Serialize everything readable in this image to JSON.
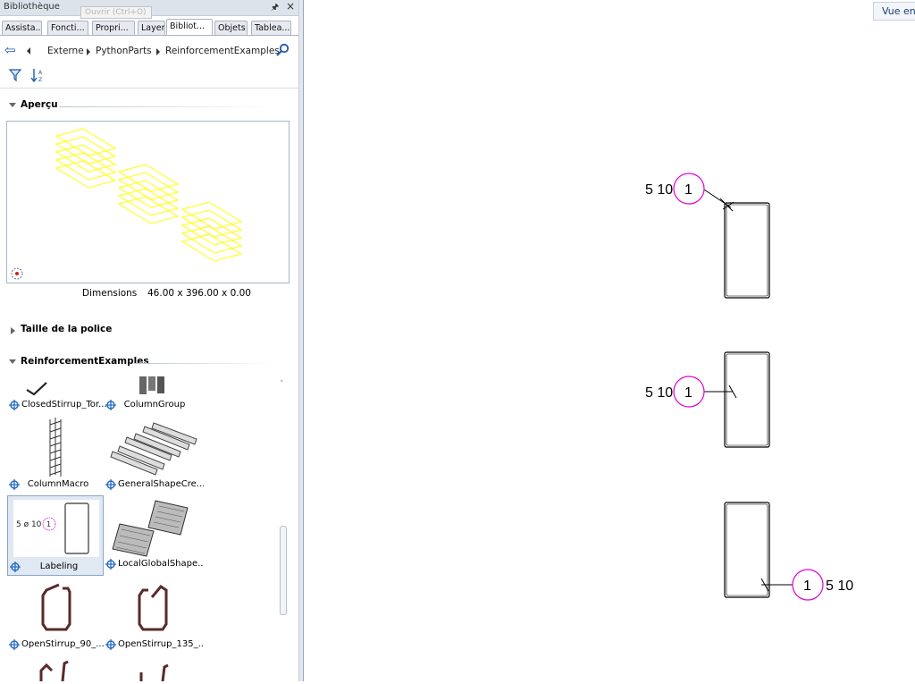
{
  "panel": {
    "title": "Bibliothèque",
    "pin_icon": "pin-icon",
    "close_icon": "close-icon",
    "tooltip_text": "Ouvrir (Ctrl+O)"
  },
  "tabs": [
    "Assista...",
    "Foncti...",
    "Propri...",
    "Layer",
    "Bibliot...",
    "Objets",
    "Tablea..."
  ],
  "active_tab": "Bibliot...",
  "breadcrumb": [
    "Externe",
    "PythonParts",
    "ReinforcementExamples"
  ],
  "sections": {
    "preview": "Aperçu",
    "font": "Taille de la police",
    "examples": "ReinforcementExamples"
  },
  "dimensions": {
    "label": "Dimensions",
    "value": "46.00 x 396.00 x 0.00"
  },
  "library_items": [
    {
      "label": "ClosedStirrup_Tor..."
    },
    {
      "label": "ColumnGroup"
    },
    {
      "label": "ColumnMacro"
    },
    {
      "label": "GeneralShapeCre..."
    },
    {
      "label": "Labeling",
      "selected": true,
      "thumb_text": "5 ø 10"
    },
    {
      "label": "LocalGlobalShape..."
    },
    {
      "label": "OpenStirrup_90_..."
    },
    {
      "label": "OpenStirrup_135_..."
    }
  ],
  "thumb_circle_number": "1",
  "canvas": {
    "view_button": "Vue en",
    "labels": [
      {
        "bar_text": "5 10",
        "position_number": "1"
      },
      {
        "bar_text": "5 10",
        "position_number": "1"
      },
      {
        "bar_text": "5 10",
        "position_number": "1"
      }
    ]
  },
  "colors": {
    "preview_lines": "#ffff00",
    "label_circle": "#e000d0",
    "accent": "#1e5aa8"
  }
}
